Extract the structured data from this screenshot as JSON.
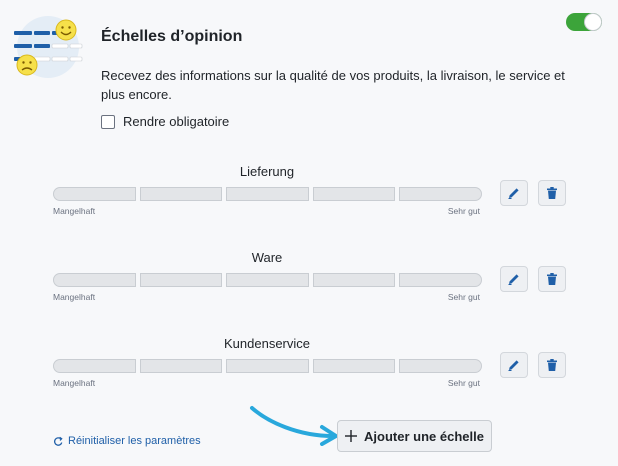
{
  "header": {
    "title": "Échelles d’opinion",
    "description": "Recevez des informations sur la qualité de vos produits, la livraison, le service et plus encore.",
    "enabled": true
  },
  "required": {
    "label": "Rendre obligatoire",
    "checked": false
  },
  "scales": [
    {
      "name": "Lieferung",
      "low_label": "Mangelhaft",
      "high_label": "Sehr gut",
      "steps": 5
    },
    {
      "name": "Ware",
      "low_label": "Mangelhaft",
      "high_label": "Sehr gut",
      "steps": 5
    },
    {
      "name": "Kundenservice",
      "low_label": "Mangelhaft",
      "high_label": "Sehr gut",
      "steps": 5
    }
  ],
  "footer": {
    "reset_label": "Réinitialiser les paramètres",
    "add_label": "Ajouter une échelle"
  },
  "colors": {
    "accent": "#1f5fa8",
    "toggle_on": "#3ca43a",
    "bar_fill": "#e3e5e8",
    "arrow": "#29a8dc"
  }
}
